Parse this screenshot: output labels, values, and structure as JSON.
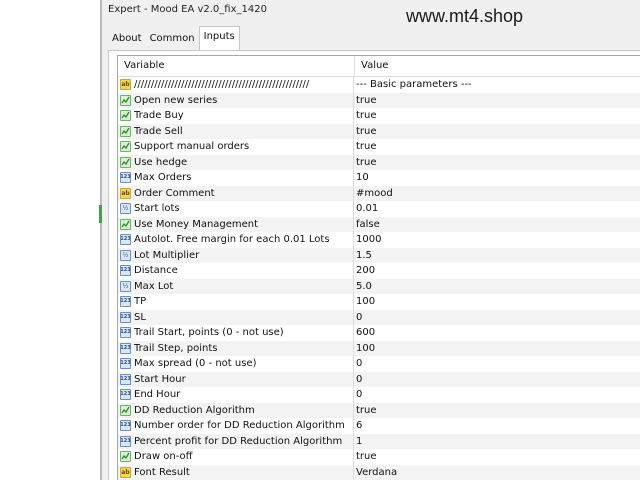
{
  "window": {
    "title": "Expert - Mood EA v2.0_fix_1420",
    "watermark": "www.mt4.shop"
  },
  "tabs": [
    {
      "label": "About",
      "active": false
    },
    {
      "label": "Common",
      "active": false
    },
    {
      "label": "Inputs",
      "active": true
    }
  ],
  "table": {
    "headers": {
      "variable": "Variable",
      "value": "Value"
    },
    "rows": [
      {
        "icon": "text-icon",
        "variable": "////////////////////////////////////////////////////",
        "value": "--- Basic parameters ---"
      },
      {
        "icon": "bool-icon",
        "variable": "Open new series",
        "value": "true"
      },
      {
        "icon": "bool-icon",
        "variable": "Trade Buy",
        "value": "true"
      },
      {
        "icon": "bool-icon",
        "variable": "Trade Sell",
        "value": "true"
      },
      {
        "icon": "bool-icon",
        "variable": "Support manual orders",
        "value": "true"
      },
      {
        "icon": "bool-icon",
        "variable": "Use hedge",
        "value": "true"
      },
      {
        "icon": "int-icon",
        "variable": "Max Orders",
        "value": "10"
      },
      {
        "icon": "text-icon",
        "variable": "Order Comment",
        "value": "#mood"
      },
      {
        "icon": "double-icon",
        "variable": "Start lots",
        "value": "0.01"
      },
      {
        "icon": "bool-icon",
        "variable": "Use Money Management",
        "value": "false"
      },
      {
        "icon": "int-icon",
        "variable": "Autolot. Free margin for each 0.01 Lots",
        "value": "1000"
      },
      {
        "icon": "double-icon",
        "variable": "Lot Multiplier",
        "value": "1.5"
      },
      {
        "icon": "int-icon",
        "variable": "Distance",
        "value": "200"
      },
      {
        "icon": "double-icon",
        "variable": "Max Lot",
        "value": "5.0"
      },
      {
        "icon": "int-icon",
        "variable": "TP",
        "value": "100"
      },
      {
        "icon": "int-icon",
        "variable": "SL",
        "value": "0"
      },
      {
        "icon": "int-icon",
        "variable": "Trail Start, points (0 - not use)",
        "value": "600"
      },
      {
        "icon": "int-icon",
        "variable": "Trail Step, points",
        "value": "100"
      },
      {
        "icon": "int-icon",
        "variable": "Max spread (0 - not use)",
        "value": "0"
      },
      {
        "icon": "int-icon",
        "variable": "Start Hour",
        "value": "0"
      },
      {
        "icon": "int-icon",
        "variable": "End Hour",
        "value": "0"
      },
      {
        "icon": "bool-icon",
        "variable": "DD Reduction Algorithm",
        "value": "true"
      },
      {
        "icon": "int-icon",
        "variable": "Number order for DD Reduction Algorithm",
        "value": "6"
      },
      {
        "icon": "int-icon",
        "variable": "Percent profit for DD Reduction Algorithm",
        "value": "1"
      },
      {
        "icon": "bool-icon",
        "variable": "Draw on-off",
        "value": "true"
      },
      {
        "icon": "text-icon",
        "variable": "Font Result",
        "value": "Verdana"
      }
    ]
  },
  "icon_labels": {
    "text": "ab",
    "int": "123",
    "double": "½"
  }
}
